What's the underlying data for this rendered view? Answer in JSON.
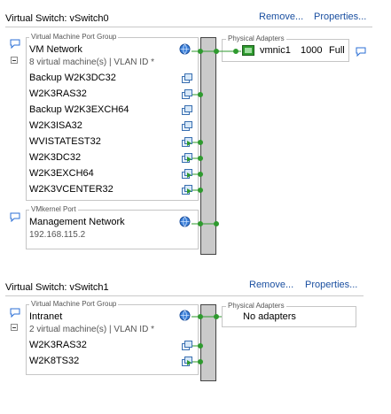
{
  "switch0": {
    "title": "Virtual Switch: vSwitch0",
    "remove_label": "Remove...",
    "properties_label": "Properties...",
    "vm_group": {
      "legend": "Virtual Machine Port Group",
      "name": "VM Network",
      "summary": "8 virtual machine(s) | VLAN ID *",
      "vms": [
        {
          "name": "Backup W2K3DC32",
          "icon": "vm-powered-off-icon",
          "connected": false
        },
        {
          "name": "W2K3RAS32",
          "icon": "vm-powered-off-icon",
          "connected": true
        },
        {
          "name": "Backup W2K3EXCH64",
          "icon": "vm-powered-off-icon",
          "connected": false
        },
        {
          "name": "W2K3ISA32",
          "icon": "vm-powered-off-icon",
          "connected": false
        },
        {
          "name": "WVISTATEST32",
          "icon": "vm-powered-on-icon",
          "connected": true
        },
        {
          "name": "W2K3DC32",
          "icon": "vm-powered-on-icon",
          "connected": true
        },
        {
          "name": "W2K3EXCH64",
          "icon": "vm-powered-on-icon",
          "connected": true
        },
        {
          "name": "W2K3VCENTER32",
          "icon": "vm-powered-on-icon",
          "connected": true
        }
      ]
    },
    "vmk_group": {
      "legend": "VMkernel Port",
      "name": "Management Network",
      "ip": "192.168.115.2"
    },
    "adapters": {
      "legend": "Physical Adapters",
      "nic_name": "vmnic1",
      "nic_speed": "1000",
      "nic_duplex": "Full"
    }
  },
  "switch1": {
    "title": "Virtual Switch: vSwitch1",
    "remove_label": "Remove...",
    "properties_label": "Properties...",
    "vm_group": {
      "legend": "Virtual Machine Port Group",
      "name": "Intranet",
      "summary": "2 virtual machine(s) | VLAN ID *",
      "vms": [
        {
          "name": "W2K3RAS32",
          "icon": "vm-powered-off-icon",
          "connected": true
        },
        {
          "name": "W2K8TS32",
          "icon": "vm-powered-on-icon",
          "connected": true
        }
      ]
    },
    "adapters": {
      "legend": "Physical Adapters",
      "empty_text": "No adapters"
    }
  },
  "colors": {
    "link": "#1a4fa0",
    "connector_green": "#2e9a2e",
    "switch_bar": "#cacaca",
    "group_border": "#c6c6c6"
  }
}
